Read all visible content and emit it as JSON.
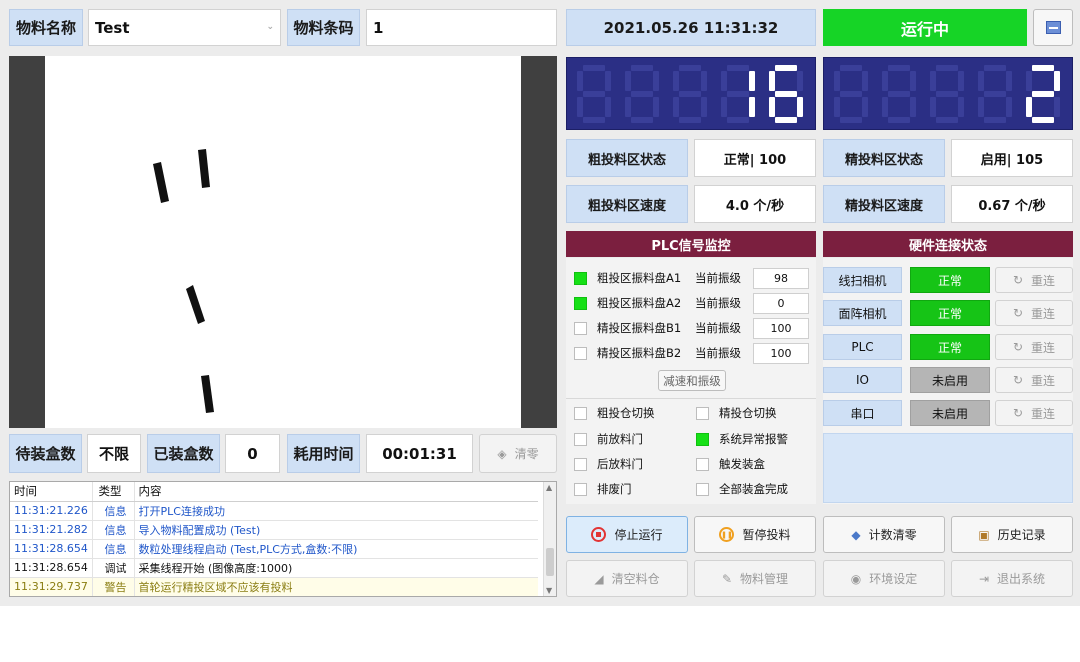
{
  "top": {
    "material_name_label": "物料名称",
    "material_name_value": "Test",
    "material_barcode_label": "物料条码",
    "material_barcode_value": "1"
  },
  "header": {
    "datetime": "2021.05.26 11:31:32",
    "run_status": "运行中",
    "run_status_color": "#16d426"
  },
  "counters": {
    "coarse_count": "16",
    "fine_count": "2"
  },
  "zones": {
    "coarse_state_label": "粗投料区状态",
    "coarse_state_value": "正常| 100",
    "fine_state_label": "精投料区状态",
    "fine_state_value": "启用| 105",
    "coarse_speed_label": "粗投料区速度",
    "coarse_speed_value": "4.0 个/秒",
    "fine_speed_label": "精投料区速度",
    "fine_speed_value": "0.67 个/秒"
  },
  "plc": {
    "title": "PLC信号监控",
    "level_label": "当前振级",
    "rows": [
      {
        "name": "粗投区振料盘A1",
        "active": true,
        "level": "98"
      },
      {
        "name": "粗投区振料盘A2",
        "active": true,
        "level": "0"
      },
      {
        "name": "精投区振料盘B1",
        "active": false,
        "level": "100"
      },
      {
        "name": "精投区振料盘B2",
        "active": false,
        "level": "100"
      }
    ],
    "slow_button": "减速和振级",
    "signals": [
      {
        "name": "粗投仓切换",
        "active": false
      },
      {
        "name": "精投仓切换",
        "active": false
      },
      {
        "name": "前放料门",
        "active": false
      },
      {
        "name": "系统异常报警",
        "active": true
      },
      {
        "name": "后放料门",
        "active": false
      },
      {
        "name": "触发装盒",
        "active": false
      },
      {
        "name": "排废门",
        "active": false
      },
      {
        "name": "全部装盒完成",
        "active": false
      }
    ]
  },
  "hardware": {
    "title": "硬件连接状态",
    "reconnect_label": "重连",
    "rows": [
      {
        "name": "线扫相机",
        "status": "正常",
        "ok": true
      },
      {
        "name": "面阵相机",
        "status": "正常",
        "ok": true
      },
      {
        "name": "PLC",
        "status": "正常",
        "ok": true
      },
      {
        "name": "IO",
        "status": "未启用",
        "ok": false
      },
      {
        "name": "串口",
        "status": "未启用",
        "ok": false
      }
    ]
  },
  "boxes": {
    "pending_label": "待装盒数",
    "pending_value": "不限",
    "done_label": "已装盒数",
    "done_value": "0",
    "elapsed_label": "耗用时间",
    "elapsed_value": "00:01:31",
    "clear_button": "清零"
  },
  "log": {
    "headers": [
      "时间",
      "类型",
      "内容"
    ],
    "rows": [
      {
        "time": "11:31:21.226",
        "type": "信息",
        "content": "打开PLC连接成功",
        "level": "info"
      },
      {
        "time": "11:31:21.282",
        "type": "信息",
        "content": "导入物料配置成功 (Test)",
        "level": "info"
      },
      {
        "time": "11:31:28.654",
        "type": "信息",
        "content": "数粒处理线程启动 (Test,PLC方式,盒数:不限)",
        "level": "info"
      },
      {
        "time": "11:31:28.654",
        "type": "调试",
        "content": "采集线程开始 (图像高度:1000)",
        "level": "debug"
      },
      {
        "time": "11:31:29.737",
        "type": "警告",
        "content": "首轮运行精投区域不应该有投料",
        "level": "warn"
      }
    ]
  },
  "actions": {
    "stop": "停止运行",
    "pause": "暂停投料",
    "count_clear": "计数清零",
    "history": "历史记录",
    "empty_bin": "清空料仓",
    "material_mgmt": "物料管理",
    "env_settings": "环境设定",
    "exit": "退出系统"
  }
}
